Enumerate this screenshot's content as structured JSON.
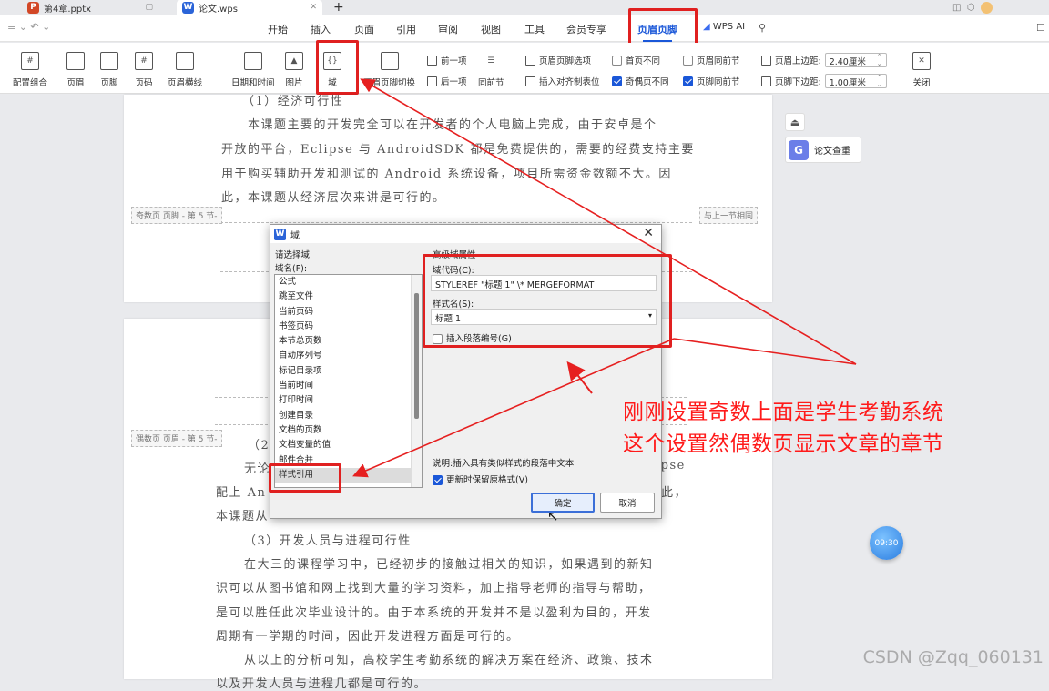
{
  "file_tabs": [
    {
      "icon": "P",
      "name": "第4章.pptx",
      "color": "#d24726"
    },
    {
      "icon": "W",
      "name": "论文.wps",
      "color": "#2b64d8"
    }
  ],
  "new_tab": "+",
  "menu_tabs": [
    "开始",
    "插入",
    "页面",
    "引用",
    "审阅",
    "视图",
    "工具",
    "会员专享",
    "页眉页脚"
  ],
  "active_menu": "页眉页脚",
  "wps_ai": "WPS AI",
  "ribbon": {
    "big_buttons": [
      "配置组合",
      "页眉",
      "页脚",
      "页码",
      "页眉横线",
      "日期和时间",
      "图片",
      "域",
      "页眉页脚切换"
    ],
    "prev_section": "前一项",
    "next_section": "后一项",
    "same_as_prev": "同前节",
    "header_footer_options": "页眉页脚选项",
    "insert_align_tab": "插入对齐制表位",
    "diff_first_page": "首页不同",
    "diff_odd_even": "奇偶页不同",
    "header_same_prev": "页眉同前节",
    "footer_same_prev": "页脚同前节",
    "header_top_margin_label": "页眉上边距:",
    "header_top_margin_value": "2.40厘米",
    "footer_bottom_margin_label": "页脚下边距:",
    "footer_bottom_margin_value": "1.00厘米",
    "close": "关闭"
  },
  "document": {
    "page1_lines": [
      "（1）经济可行性",
      "本课题主要的开发完全可以在开发者的个人电脑上完成，由于安卓是个",
      "开放的平台，Eclipse 与 AndroidSDK 都是免费提供的，需要的经费支持主要",
      "用于购买辅助开发和测试的 Android 系统设备，项目所需资金数额不大。因",
      "此，本课题从经济层次来讲是可行的。"
    ],
    "odd_footer_label": "奇数页 页脚 - 第 5 节-",
    "same_prev_label": "与上一节相同",
    "even_header_label": "偶数页 页眉 - 第 5 节-",
    "page2_fragments": {
      "l1": "（2）",
      "l2a": "无论",
      "l2b": "ipse",
      "l3a": "配上 An",
      "l3b": "此，",
      "l4": "本课题从"
    },
    "page2_lines": [
      "（3）开发人员与进程可行性",
      "在大三的课程学习中，已经初步的接触过相关的知识，如果遇到的新知",
      "识可以从图书馆和网上找到大量的学习资料，加上指导老师的指导与帮助，",
      "是可以胜任此次毕业设计的。由于本系统的开发并不是以盈利为目的，开发",
      "周期有一学期的时间，因此开发进程方面是可行的。",
      "从以上的分析可知，高校学生考勤系统的解决方案在经济、政策、技术",
      "以及开发人员与进程几都是可行的。"
    ]
  },
  "dialog": {
    "title": "域",
    "choose_field": "请选择域",
    "field_name_label": "域名(F):",
    "field_names": [
      "公式",
      "跳至文件",
      "当前页码",
      "书签页码",
      "本节总页数",
      "自动序列号",
      "标记目录项",
      "当前时间",
      "打印时间",
      "创建目录",
      "文档的页数",
      "文档变量的值",
      "邮件合并",
      "样式引用"
    ],
    "selected_field": "样式引用",
    "advanced_props": "高级域属性",
    "field_code_label": "域代码(C):",
    "field_code_value": "STYLEREF \"标题 1\" \\* MERGEFORMAT",
    "style_name_label": "样式名(S):",
    "style_name_value": "标题 1",
    "insert_para_num": "插入段落编号(G)",
    "description": "说明:插入具有类似样式的段落中文本",
    "keep_format": "更新时保留原格式(V)",
    "ok": "确定",
    "cancel": "取消"
  },
  "side_panel": {
    "paper_check": "论文查重"
  },
  "annotation": {
    "line1": "刚刚设置奇数上面是学生考勤系统",
    "line2": "这个设置然偶数页显示文章的章节"
  },
  "timer": "09:30",
  "watermark": "CSDN @Zqq_060131"
}
